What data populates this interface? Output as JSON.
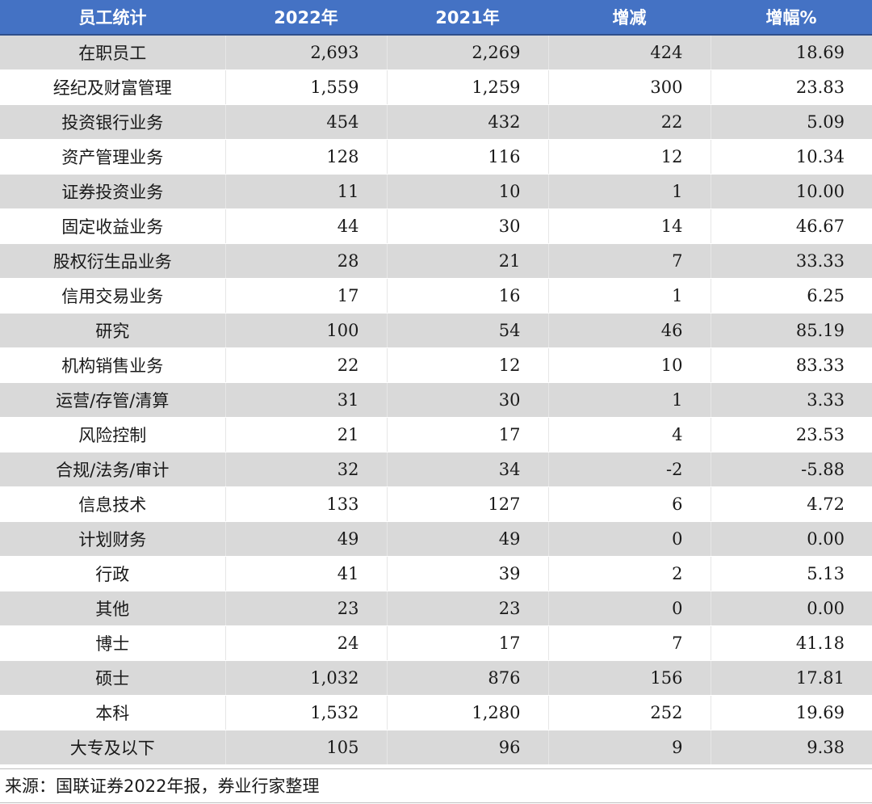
{
  "table": {
    "headers": [
      "员工统计",
      "2022年",
      "2021年",
      "增减",
      "增幅%"
    ],
    "rows": [
      [
        "在职员工",
        "2,693",
        "2,269",
        "424",
        "18.69"
      ],
      [
        "经纪及财富管理",
        "1,559",
        "1,259",
        "300",
        "23.83"
      ],
      [
        "投资银行业务",
        "454",
        "432",
        "22",
        "5.09"
      ],
      [
        "资产管理业务",
        "128",
        "116",
        "12",
        "10.34"
      ],
      [
        "证券投资业务",
        "11",
        "10",
        "1",
        "10.00"
      ],
      [
        "固定收益业务",
        "44",
        "30",
        "14",
        "46.67"
      ],
      [
        "股权衍生品业务",
        "28",
        "21",
        "7",
        "33.33"
      ],
      [
        "信用交易业务",
        "17",
        "16",
        "1",
        "6.25"
      ],
      [
        "研究",
        "100",
        "54",
        "46",
        "85.19"
      ],
      [
        "机构销售业务",
        "22",
        "12",
        "10",
        "83.33"
      ],
      [
        "运营/存管/清算",
        "31",
        "30",
        "1",
        "3.33"
      ],
      [
        "风险控制",
        "21",
        "17",
        "4",
        "23.53"
      ],
      [
        "合规/法务/审计",
        "32",
        "34",
        "-2",
        "-5.88"
      ],
      [
        "信息技术",
        "133",
        "127",
        "6",
        "4.72"
      ],
      [
        "计划财务",
        "49",
        "49",
        "0",
        "0.00"
      ],
      [
        "行政",
        "41",
        "39",
        "2",
        "5.13"
      ],
      [
        "其他",
        "23",
        "23",
        "0",
        "0.00"
      ],
      [
        "博士",
        "24",
        "17",
        "7",
        "41.18"
      ],
      [
        "硕士",
        "1,032",
        "876",
        "156",
        "17.81"
      ],
      [
        "本科",
        "1,532",
        "1,280",
        "252",
        "19.69"
      ],
      [
        "大专及以下",
        "105",
        "96",
        "9",
        "9.38"
      ]
    ]
  },
  "source": "来源：国联证券2022年报，券业行家整理",
  "colors": {
    "header_bg": "#4472c4",
    "stripe_bg": "#d9d9d9"
  }
}
